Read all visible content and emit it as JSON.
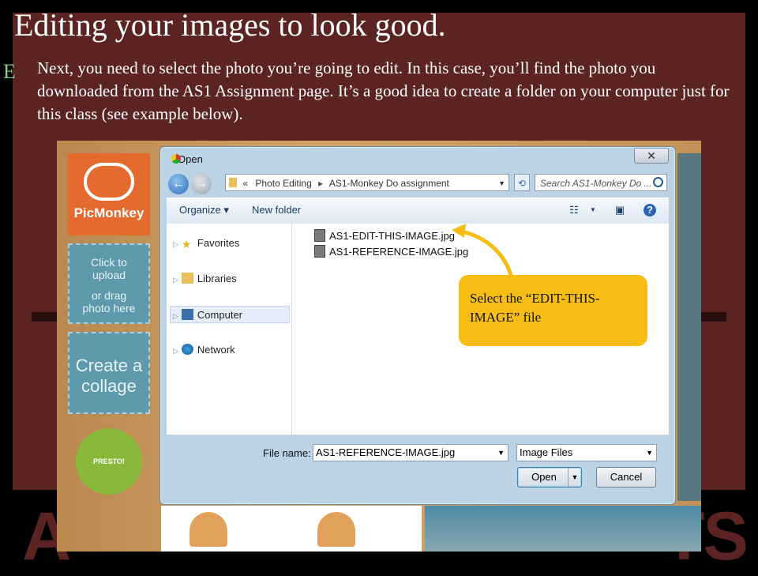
{
  "slide": {
    "title": "Editing your images to look good.",
    "bullet": "E",
    "body": "Next, you need to select the photo you’re going to edit. In this case, you’ll find the photo you downloaded from the AS1 Assignment page. It’s a good idea to create a folder on your computer just for this class (see example below)."
  },
  "background": {
    "letters_left": "A",
    "letters_right": "TS"
  },
  "picmonkey": {
    "logo": "PicMonkey",
    "upload_tile": [
      "Click to",
      "upload",
      "or drag",
      "photo here"
    ],
    "collage_tile": [
      "Create a",
      "collage"
    ],
    "presto_badge": "PRESTO!"
  },
  "dialog": {
    "title": "Open",
    "close": "✕",
    "breadcrumb": [
      "«",
      "Photo Editing",
      "AS1-Monkey Do assignment"
    ],
    "search_placeholder": "Search AS1-Monkey Do ...",
    "toolbar": {
      "organize": "Organize ▾",
      "new_folder": "New folder"
    },
    "nav_items": [
      {
        "label": "Favorites",
        "icon": "star-icon"
      },
      {
        "label": "Libraries",
        "icon": "libraries-icon"
      },
      {
        "label": "Computer",
        "icon": "computer-icon",
        "selected": true
      },
      {
        "label": "Network",
        "icon": "network-icon"
      }
    ],
    "files": [
      "AS1-EDIT-THIS-IMAGE.jpg",
      "AS1-REFERENCE-IMAGE.jpg"
    ],
    "file_name_label": "File name:",
    "file_name_value": "AS1-REFERENCE-IMAGE.jpg",
    "file_type": "Image Files",
    "open_button": "Open",
    "cancel_button": "Cancel"
  },
  "callout": {
    "text": "Select the “EDIT-THIS-IMAGE” file"
  },
  "colors": {
    "maroon": "#5b2423",
    "callout": "#f6be14",
    "bullet": "#7fd07f"
  }
}
